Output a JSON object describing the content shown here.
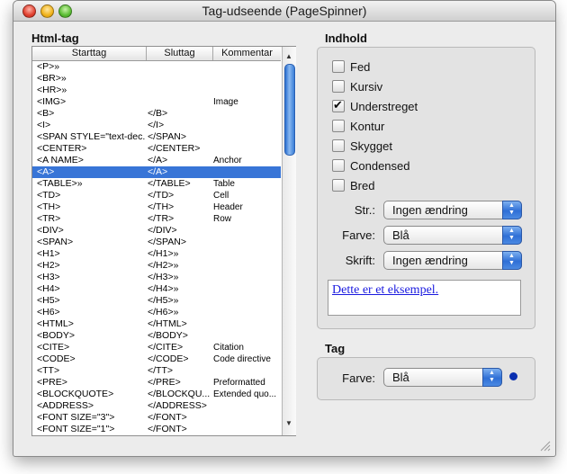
{
  "window": {
    "title": "Tag-udseende (PageSpinner)"
  },
  "left": {
    "heading": "Html-tag",
    "columns": [
      "Starttag",
      "Sluttag",
      "Kommentar"
    ],
    "selected_index": 9,
    "rows": [
      {
        "start": "<P>»",
        "end": "",
        "comment": ""
      },
      {
        "start": "<BR>»",
        "end": "",
        "comment": ""
      },
      {
        "start": "<HR>»",
        "end": "",
        "comment": ""
      },
      {
        "start": "<IMG>",
        "end": "",
        "comment": "Image"
      },
      {
        "start": "<B>",
        "end": "</B>",
        "comment": ""
      },
      {
        "start": "<I>",
        "end": "</I>",
        "comment": ""
      },
      {
        "start": "<SPAN STYLE=\"text-dec...",
        "end": "</SPAN>",
        "comment": ""
      },
      {
        "start": "<CENTER>",
        "end": "</CENTER>",
        "comment": ""
      },
      {
        "start": "<A NAME>",
        "end": "</A>",
        "comment": "Anchor"
      },
      {
        "start": "<A>",
        "end": "</A>",
        "comment": ""
      },
      {
        "start": "<TABLE>»",
        "end": "</TABLE>",
        "comment": "Table"
      },
      {
        "start": "<TD>",
        "end": "</TD>",
        "comment": "Cell"
      },
      {
        "start": "<TH>",
        "end": "</TH>",
        "comment": "Header"
      },
      {
        "start": "<TR>",
        "end": "</TR>",
        "comment": "Row"
      },
      {
        "start": "<DIV>",
        "end": "</DIV>",
        "comment": ""
      },
      {
        "start": "<SPAN>",
        "end": "</SPAN>",
        "comment": ""
      },
      {
        "start": "<H1>",
        "end": "</H1>»",
        "comment": ""
      },
      {
        "start": "<H2>",
        "end": "</H2>»",
        "comment": ""
      },
      {
        "start": "<H3>",
        "end": "</H3>»",
        "comment": ""
      },
      {
        "start": "<H4>",
        "end": "</H4>»",
        "comment": ""
      },
      {
        "start": "<H5>",
        "end": "</H5>»",
        "comment": ""
      },
      {
        "start": "<H6>",
        "end": "</H6>»",
        "comment": ""
      },
      {
        "start": "<HTML>",
        "end": "</HTML>",
        "comment": ""
      },
      {
        "start": "<BODY>",
        "end": "</BODY>",
        "comment": ""
      },
      {
        "start": "<CITE>",
        "end": "</CITE>",
        "comment": "Citation"
      },
      {
        "start": "<CODE>",
        "end": "</CODE>",
        "comment": "Code directive"
      },
      {
        "start": "<TT>",
        "end": "</TT>",
        "comment": ""
      },
      {
        "start": "<PRE>",
        "end": "</PRE>",
        "comment": "Preformatted"
      },
      {
        "start": "<BLOCKQUOTE>",
        "end": "</BLOCKQU...",
        "comment": "Extended quo..."
      },
      {
        "start": "<ADDRESS>",
        "end": "</ADDRESS>",
        "comment": ""
      },
      {
        "start": "<FONT SIZE=\"3\">",
        "end": "</FONT>",
        "comment": ""
      },
      {
        "start": "<FONT SIZE=\"1\">",
        "end": "</FONT>",
        "comment": ""
      }
    ]
  },
  "content": {
    "heading": "Indhold",
    "checkboxes": [
      {
        "label": "Fed",
        "checked": false
      },
      {
        "label": "Kursiv",
        "checked": false
      },
      {
        "label": "Understreget",
        "checked": true
      },
      {
        "label": "Kontur",
        "checked": false
      },
      {
        "label": "Skygget",
        "checked": false
      },
      {
        "label": "Condensed",
        "checked": false
      },
      {
        "label": "Bred",
        "checked": false
      }
    ],
    "size_label": "Str.:",
    "size_value": "Ingen ændring",
    "color_label": "Farve:",
    "color_value": "Blå",
    "font_label": "Skrift:",
    "font_value": "Ingen ændring",
    "sample_text": "Dette er et eksempel."
  },
  "tag": {
    "heading": "Tag",
    "color_label": "Farve:",
    "color_value": "Blå",
    "swatch_color": "#0a2fb0"
  },
  "colors": {
    "selection": "#3875d7",
    "link": "#1a1adf"
  }
}
